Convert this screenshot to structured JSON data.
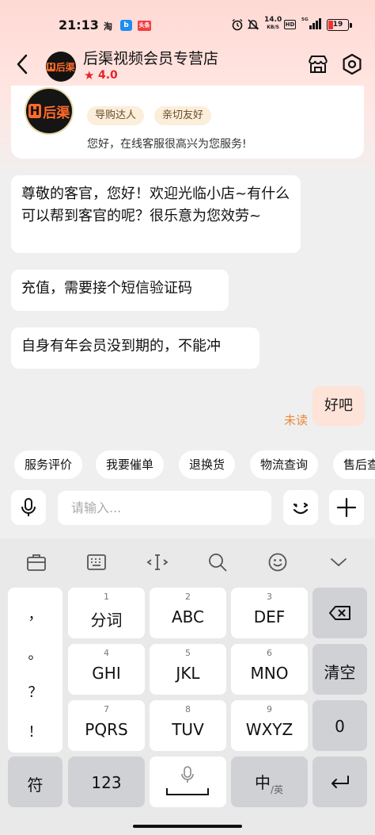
{
  "status_bar": {
    "time": "21:13",
    "app_taobao": "淘",
    "app_bili": "b",
    "app_toutiao": "头条",
    "net_speed_value": "14.0",
    "net_speed_unit": "KB/S",
    "hd": "HD",
    "signal": "⁵ᴳ",
    "battery": "19",
    "battery_color": "#e33333"
  },
  "header": {
    "back_icon": "chevron-left-icon",
    "shop_logo_text": "后渠",
    "shop_logo_h": "H",
    "shop_name": "后渠视频会员专营店",
    "rating": "4.0",
    "store_icon": "store-icon",
    "settings_icon": "hexagon-settings-icon"
  },
  "agent_card": {
    "avatar_text": "后渠",
    "avatar_h": "H",
    "tags": [
      "导购达人",
      "亲切友好"
    ],
    "greeting": "您好，在线客服很高兴为您服务!"
  },
  "messages": [
    {
      "from": "shop",
      "text": "尊敬的客官，您好！欢迎光临小店~有什么可以帮到客官的呢？很乐意为您效劳~"
    },
    {
      "from": "shop",
      "text": "充值，需要接个短信验证码"
    },
    {
      "from": "shop",
      "text": "自身有年会员没到期的，不能冲"
    },
    {
      "from": "me",
      "text": "好吧",
      "status": "未读"
    }
  ],
  "quick_replies": [
    "服务评价",
    "我要催单",
    "退换货",
    "物流查询",
    "售后查询"
  ],
  "input": {
    "placeholder": "请输入..."
  },
  "keyboard": {
    "toolbar_icons": [
      "briefcase-icon",
      "keyboard-icon",
      "cursor-icon",
      "search-icon",
      "smiley-icon",
      "chevron-down-icon"
    ],
    "symbols": [
      "，",
      "。",
      "？",
      "！"
    ],
    "rows": [
      [
        {
          "num": "1",
          "label": "分词"
        },
        {
          "num": "2",
          "label": "ABC"
        },
        {
          "num": "3",
          "label": "DEF"
        }
      ],
      [
        {
          "num": "4",
          "label": "GHI"
        },
        {
          "num": "5",
          "label": "JKL"
        },
        {
          "num": "6",
          "label": "MNO"
        }
      ],
      [
        {
          "num": "7",
          "label": "PQRS"
        },
        {
          "num": "8",
          "label": "TUV"
        },
        {
          "num": "9",
          "label": "WXYZ"
        }
      ]
    ],
    "backspace_icon": "backspace-icon",
    "clear": "清空",
    "zero": "0",
    "fu": "符",
    "num123": "123",
    "space_mic_icon": "mic-icon",
    "lang_main": "中",
    "lang_sub": "/英",
    "enter_icon": "enter-icon"
  },
  "colors": {
    "accent_red": "#e8242c",
    "unread_orange": "#e88a3a",
    "my_bubble": "#fde3d8",
    "tag_bg": "#fbeedb"
  }
}
